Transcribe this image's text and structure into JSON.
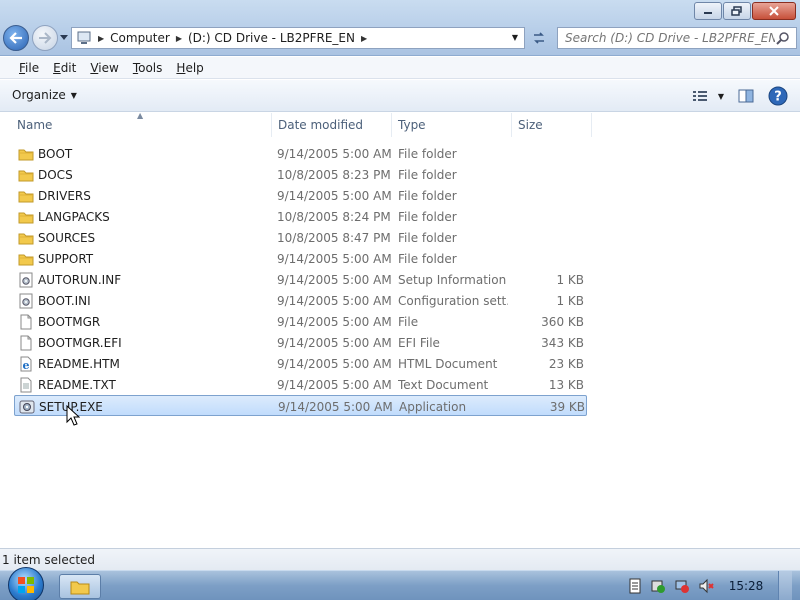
{
  "window": {
    "minimize_icon": "minimize-icon",
    "maximize_icon": "maximize-icon",
    "close_icon": "close-icon"
  },
  "address_bar": {
    "crumbs": [
      "Computer",
      "(D:) CD Drive - LB2PFRE_EN"
    ]
  },
  "search": {
    "placeholder": "Search (D:) CD Drive - LB2PFRE_EN"
  },
  "menubar": {
    "items": [
      {
        "underline": "F",
        "rest": "ile"
      },
      {
        "underline": "E",
        "rest": "dit"
      },
      {
        "underline": "V",
        "rest": "iew"
      },
      {
        "underline": "T",
        "rest": "ools"
      },
      {
        "underline": "H",
        "rest": "elp"
      }
    ]
  },
  "commandbar": {
    "organize": "Organize"
  },
  "columns": {
    "name": "Name",
    "date": "Date modified",
    "type": "Type",
    "size": "Size"
  },
  "files": [
    {
      "name": "BOOT",
      "date": "9/14/2005 5:00 AM",
      "type": "File folder",
      "size": "",
      "icon": "folder-icon"
    },
    {
      "name": "DOCS",
      "date": "10/8/2005 8:23 PM",
      "type": "File folder",
      "size": "",
      "icon": "folder-icon"
    },
    {
      "name": "DRIVERS",
      "date": "9/14/2005 5:00 AM",
      "type": "File folder",
      "size": "",
      "icon": "folder-icon"
    },
    {
      "name": "LANGPACKS",
      "date": "10/8/2005 8:24 PM",
      "type": "File folder",
      "size": "",
      "icon": "folder-icon"
    },
    {
      "name": "SOURCES",
      "date": "10/8/2005 8:47 PM",
      "type": "File folder",
      "size": "",
      "icon": "folder-icon"
    },
    {
      "name": "SUPPORT",
      "date": "9/14/2005 5:00 AM",
      "type": "File folder",
      "size": "",
      "icon": "folder-icon"
    },
    {
      "name": "AUTORUN.INF",
      "date": "9/14/2005 5:00 AM",
      "type": "Setup Information",
      "size": "1 KB",
      "icon": "settings-file-icon"
    },
    {
      "name": "BOOT.INI",
      "date": "9/14/2005 5:00 AM",
      "type": "Configuration sett...",
      "size": "1 KB",
      "icon": "settings-file-icon"
    },
    {
      "name": "BOOTMGR",
      "date": "9/14/2005 5:00 AM",
      "type": "File",
      "size": "360 KB",
      "icon": "blank-file-icon"
    },
    {
      "name": "BOOTMGR.EFI",
      "date": "9/14/2005 5:00 AM",
      "type": "EFI File",
      "size": "343 KB",
      "icon": "blank-file-icon"
    },
    {
      "name": "README.HTM",
      "date": "9/14/2005 5:00 AM",
      "type": "HTML Document",
      "size": "23 KB",
      "icon": "ie-document-icon"
    },
    {
      "name": "README.TXT",
      "date": "9/14/2005 5:00 AM",
      "type": "Text Document",
      "size": "13 KB",
      "icon": "text-file-icon"
    },
    {
      "name": "SETUP.EXE",
      "date": "9/14/2005 5:00 AM",
      "type": "Application",
      "size": "39 KB",
      "icon": "setup-app-icon",
      "selected": true
    }
  ],
  "status": {
    "text": "1 item selected"
  },
  "taskbar": {
    "clock": "15:28"
  }
}
